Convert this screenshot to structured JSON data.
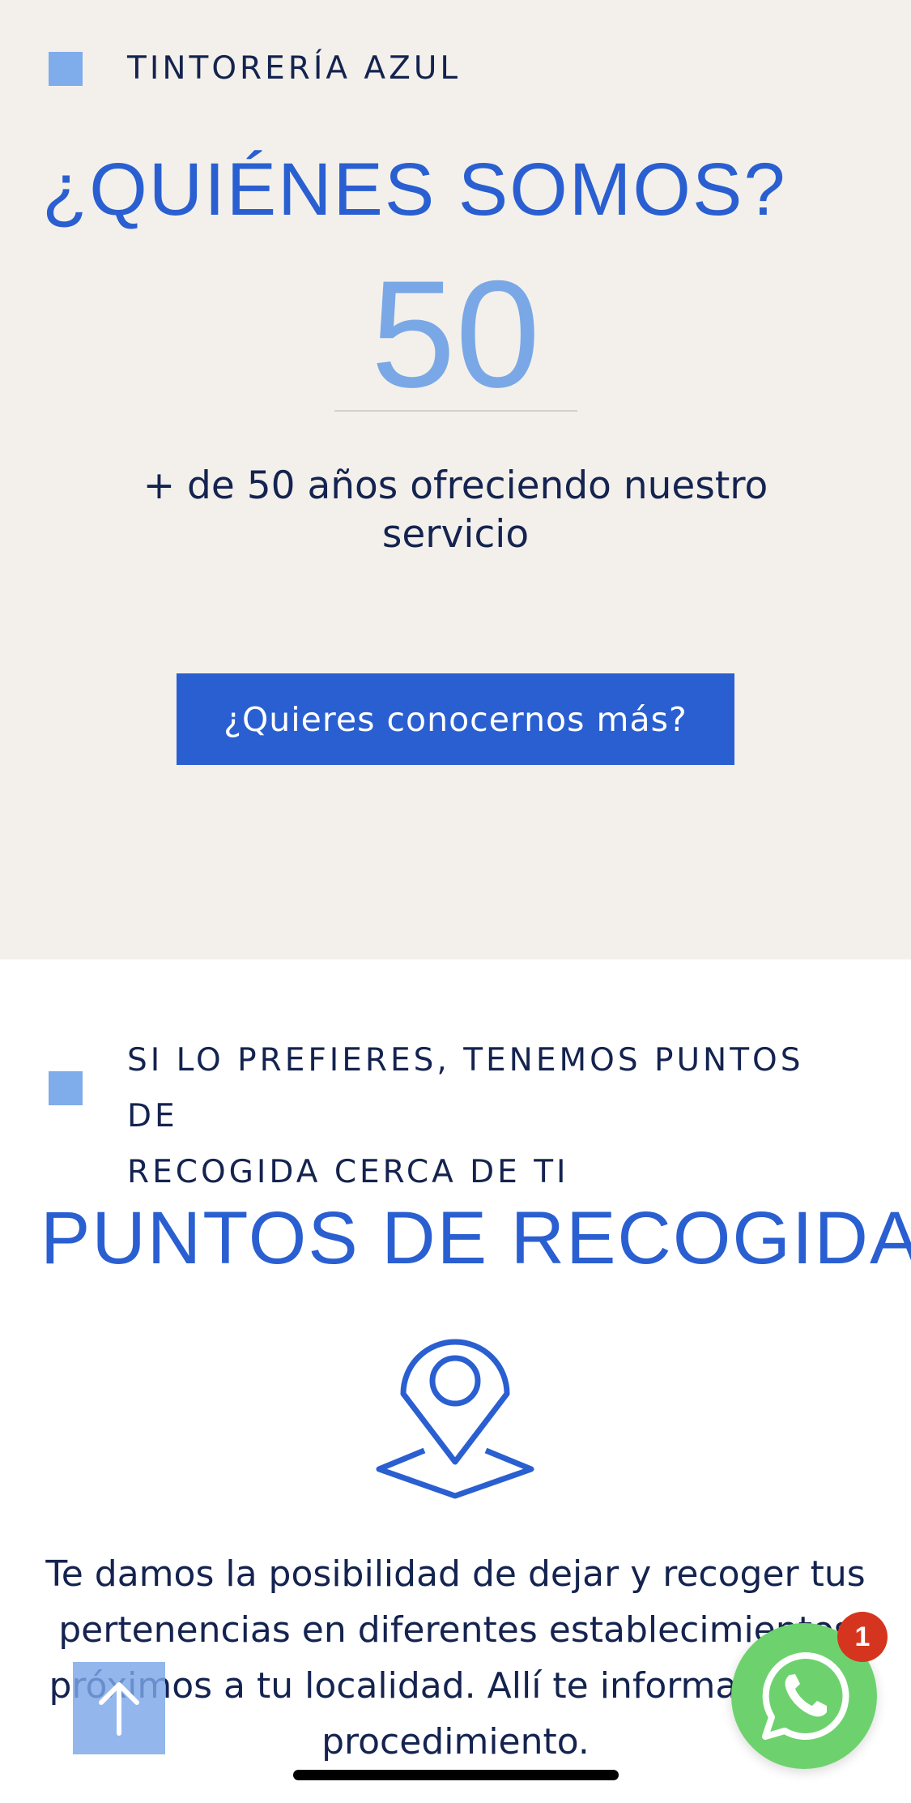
{
  "about": {
    "eyebrow": "TINTORERÍA AZUL",
    "title": "¿QUIÉNES SOMOS?",
    "counter_value": "50",
    "counter_caption": "+ de 50 años ofreciendo nuestro servicio",
    "cta_label": "¿Quieres conocernos más?"
  },
  "pickup": {
    "eyebrow_line1": "SI LO PREFIERES, TENEMOS PUNTOS DE",
    "eyebrow_line2": "RECOGIDA CERCA DE TI",
    "title": "PUNTOS DE RECOGIDA",
    "icon": "location-pin-icon",
    "description": "Te damos la posibilidad de dejar y recoger tus pertenencias en diferentes establecimientos próximos a tu localidad. Allí te informarán del procedimiento."
  },
  "floating": {
    "scroll_top_icon": "arrow-up-icon",
    "whatsapp_icon": "whatsapp-icon",
    "whatsapp_badge": "1"
  },
  "colors": {
    "accent": "#2a5fd1",
    "accent_light": "#7facea",
    "text": "#14234f",
    "section_bg": "#f3f0eb",
    "whatsapp": "#6dd26d",
    "badge": "#d5351f"
  }
}
